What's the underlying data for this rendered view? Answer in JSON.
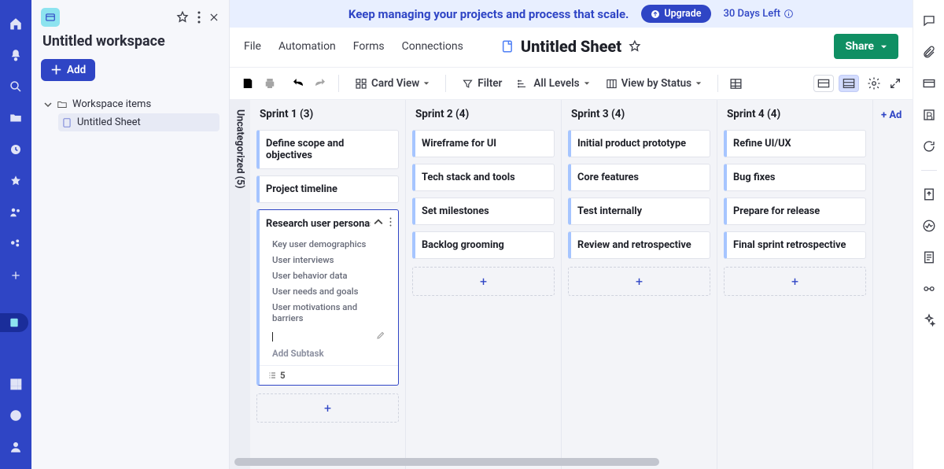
{
  "banner": {
    "text": "Keep managing your projects and process that scale.",
    "upgrade": "Upgrade",
    "days_left": "30 Days Left"
  },
  "side": {
    "workspace_title": "Untitled workspace",
    "add": "Add",
    "tree_root": "Workspace items",
    "tree_item": "Untitled Sheet"
  },
  "menu": {
    "file": "File",
    "automation": "Automation",
    "forms": "Forms",
    "connections": "Connections",
    "sheet_title": "Untitled Sheet",
    "share": "Share"
  },
  "toolbar": {
    "card_view": "Card View",
    "filter": "Filter",
    "all_levels": "All Levels",
    "view_by_status": "View by Status"
  },
  "uncategorized_label": "Uncategorized (5)",
  "columns": [
    {
      "header": "Sprint 1 (3)",
      "cards": [
        "Define scope and objectives",
        "Project timeline"
      ],
      "expanded": {
        "title": "Research user personas",
        "subtasks": [
          "Key user demographics",
          "User interviews",
          "User behavior data",
          "User needs and goals",
          "User motivations and barriers"
        ],
        "add_subtask": "Add Subtask",
        "count": "5"
      }
    },
    {
      "header": "Sprint 2 (4)",
      "cards": [
        "Wireframe for UI",
        "Tech stack and tools",
        "Set milestones",
        "Backlog grooming"
      ]
    },
    {
      "header": "Sprint 3 (4)",
      "cards": [
        "Initial product prototype",
        "Core features",
        "Test internally",
        "Review and retrospective"
      ]
    },
    {
      "header": "Sprint 4 (4)",
      "cards": [
        "Refine UI/UX",
        "Bug fixes",
        "Prepare for release",
        "Final sprint retrospective"
      ]
    }
  ],
  "add_column": "+ Ad"
}
